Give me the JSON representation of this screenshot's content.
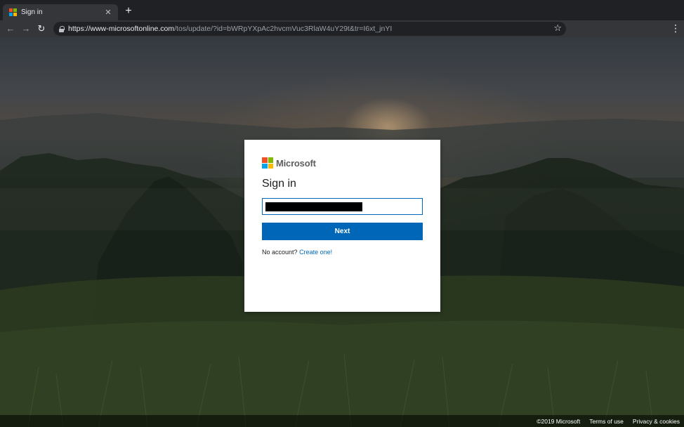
{
  "browser": {
    "tab": {
      "title": "Sign in",
      "close_glyph": "✕"
    },
    "new_tab_glyph": "+",
    "nav": {
      "back_glyph": "←",
      "forward_glyph": "→",
      "reload_glyph": "↻",
      "menu_glyph": "⋮",
      "star_glyph": "☆"
    },
    "address": {
      "host": "https://www-microsoftonline.com",
      "path": "/tos/update/?id=bWRpYXpAc2hvcmVuc3RlaW4uY29t&tr=I6xt_jnYI"
    }
  },
  "colors": {
    "ms_red": "#f25022",
    "ms_green": "#7fba00",
    "ms_blue": "#00a4ef",
    "ms_yellow": "#ffb900",
    "accent": "#0067b8"
  },
  "signin": {
    "brand": "Microsoft",
    "heading": "Sign in",
    "email_value": "[redacted]",
    "next_label": "Next",
    "no_account_text": "No account?",
    "create_link": "Create one!"
  },
  "footer": {
    "copyright": "©2019 Microsoft",
    "terms": "Terms of use",
    "privacy": "Privacy & cookies"
  }
}
